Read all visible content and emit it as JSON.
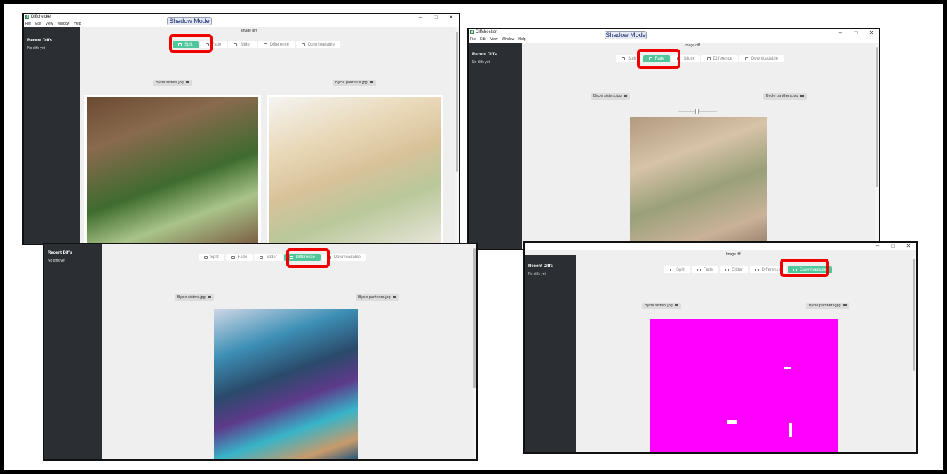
{
  "window": {
    "title": "Diffchecker",
    "shadow_button": "Shadow Mode",
    "minimize": "–",
    "maximize": "□",
    "close": "✕",
    "menu": [
      "File",
      "Edit",
      "View",
      "Window",
      "Help"
    ]
  },
  "sidebar": {
    "title": "Recent Diffs",
    "empty_text": "No diffs yet"
  },
  "content": {
    "heading": "Image diff",
    "tabs": [
      "Split",
      "Fade",
      "Slider",
      "Difference",
      "Downloadable"
    ],
    "left_file": "Bycle sisters.jpg",
    "right_file": "Bycle panthera.jpg"
  },
  "panels": [
    {
      "active_tab": "Split"
    },
    {
      "active_tab": "Fade"
    },
    {
      "active_tab": "Difference"
    },
    {
      "active_tab": "Downloadable"
    }
  ],
  "colors": {
    "accent": "#4fc79b",
    "highlight": "#e00000",
    "sidebar": "#2b2f33",
    "diff_magenta": "#ff00ff"
  }
}
